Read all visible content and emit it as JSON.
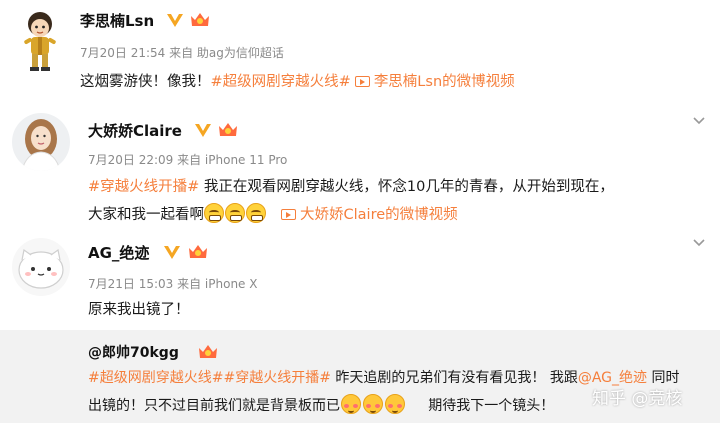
{
  "posts": [
    {
      "name": "李思楠Lsn",
      "meta": "7月20日 21:54 来自 助ag为信仰超话",
      "text_before": "这烟雾游侠！像我！",
      "tag": "#超级网剧穿越火线#",
      "video_link": "李思楠Lsn的微博视频"
    },
    {
      "name": "大娇娇Claire",
      "meta": "7月20日 22:09 来自 iPhone 11 Pro",
      "tag": "#穿越火线开播#",
      "text_line1": "我正在观看网剧穿越火线，怀念10几年的青春，从开始到现在，",
      "text_line2": "大家和我一起看啊",
      "video_link": "大娇娇Claire的微博视频"
    },
    {
      "name": "AG_绝迹",
      "meta": "7月21日 15:03 来自 iPhone X",
      "text": "原来我出镜了！"
    }
  ],
  "repost": {
    "name": "@郎帅70kgg",
    "tag1": "#超级网剧穿越火线#",
    "tag2": "#穿越火线开播#",
    "text1": "昨天追剧的兄弟们有没有看见我！ 我跟",
    "mention": "@AG_绝迹",
    "text2": "同时",
    "line2a": "出镜的！只不过目前我们就是背景板而已",
    "line2b": "期待我下一个镜头！"
  },
  "watermark": "知乎 @竞核",
  "colors": {
    "tag": "#f57f3c",
    "meta": "#8a8a8a",
    "vip": "#f5a623",
    "repost_bg": "#f2f2f2"
  }
}
